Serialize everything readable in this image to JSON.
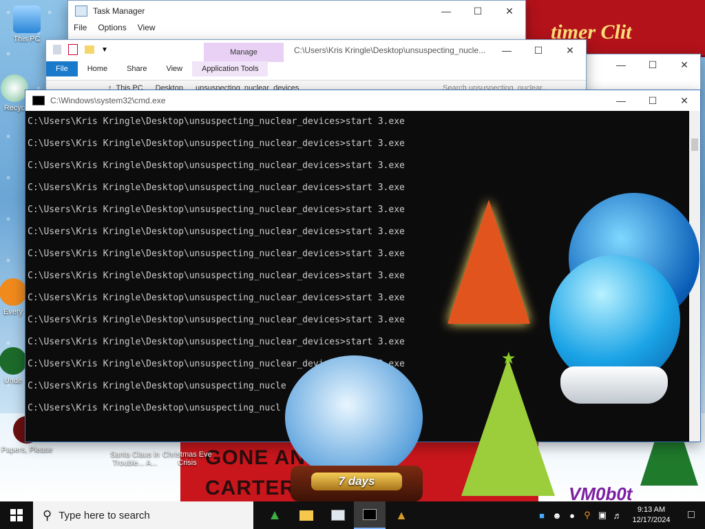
{
  "desktop": {
    "icons": [
      {
        "label": "This PC"
      },
      {
        "label": "Recyc"
      },
      {
        "label": "Every"
      },
      {
        "label": "Unde"
      },
      {
        "label": "Papers, Please"
      },
      {
        "label": "Santa Claus in Trouble... A..."
      },
      {
        "label": "Christmas Eve Crisis"
      }
    ],
    "wallpaper": {
      "banner_text": "timer Clit",
      "poster_line1": "GONE AN",
      "poster_line2": "CARTER",
      "signature": "VM0b0t"
    },
    "gadget": {
      "days_label": "7 days"
    }
  },
  "task_manager": {
    "title": "Task Manager",
    "menu": [
      "File",
      "Options",
      "View"
    ]
  },
  "explorer": {
    "title": "C:\\Users\\Kris Kringle\\Desktop\\unsuspecting_nucle...",
    "manage_tab": "Manage",
    "tabs": [
      "File",
      "Home",
      "Share",
      "View",
      "Application Tools"
    ],
    "address": [
      "This PC",
      "Desktop",
      "unsuspecting_nuclear_devices"
    ],
    "search_placeholder": "Search unsuspecting_nuclear..."
  },
  "cmd": {
    "title": "C:\\Windows\\system32\\cmd.exe",
    "lines": [
      "C:\\Users\\Kris Kringle\\Desktop\\unsuspecting_nuclear_devices>start 3.exe",
      "C:\\Users\\Kris Kringle\\Desktop\\unsuspecting_nuclear_devices>start 3.exe",
      "C:\\Users\\Kris Kringle\\Desktop\\unsuspecting_nuclear_devices>start 3.exe",
      "C:\\Users\\Kris Kringle\\Desktop\\unsuspecting_nuclear_devices>start 3.exe",
      "C:\\Users\\Kris Kringle\\Desktop\\unsuspecting_nuclear_devices>start 3.exe",
      "C:\\Users\\Kris Kringle\\Desktop\\unsuspecting_nuclear_devices>start 3.exe",
      "C:\\Users\\Kris Kringle\\Desktop\\unsuspecting_nuclear_devices>start 3.exe",
      "C:\\Users\\Kris Kringle\\Desktop\\unsuspecting_nuclear_devices>start 3.exe",
      "C:\\Users\\Kris Kringle\\Desktop\\unsuspecting_nuclear_devices>start 3.exe",
      "C:\\Users\\Kris Kringle\\Desktop\\unsuspecting_nuclear_devices>start 3.exe",
      "C:\\Users\\Kris Kringle\\Desktop\\unsuspecting_nuclear_devices>start 3.exe",
      "C:\\Users\\Kris Kringle\\Desktop\\unsuspecting_nuclear_devices>start 3.exe",
      "C:\\Users\\Kris Kringle\\Desktop\\unsuspecting_nucle",
      "C:\\Users\\Kris Kringle\\Desktop\\unsuspecting_nucl"
    ]
  },
  "taskbar": {
    "search_placeholder": "Type here to search",
    "time": "9:13 AM",
    "date": "12/17/2024"
  },
  "colors": {
    "accent": "#1979ca",
    "cmd_bg": "#0c0c0c",
    "cmd_text": "#cccccc",
    "taskbar_bg": "#101010"
  }
}
